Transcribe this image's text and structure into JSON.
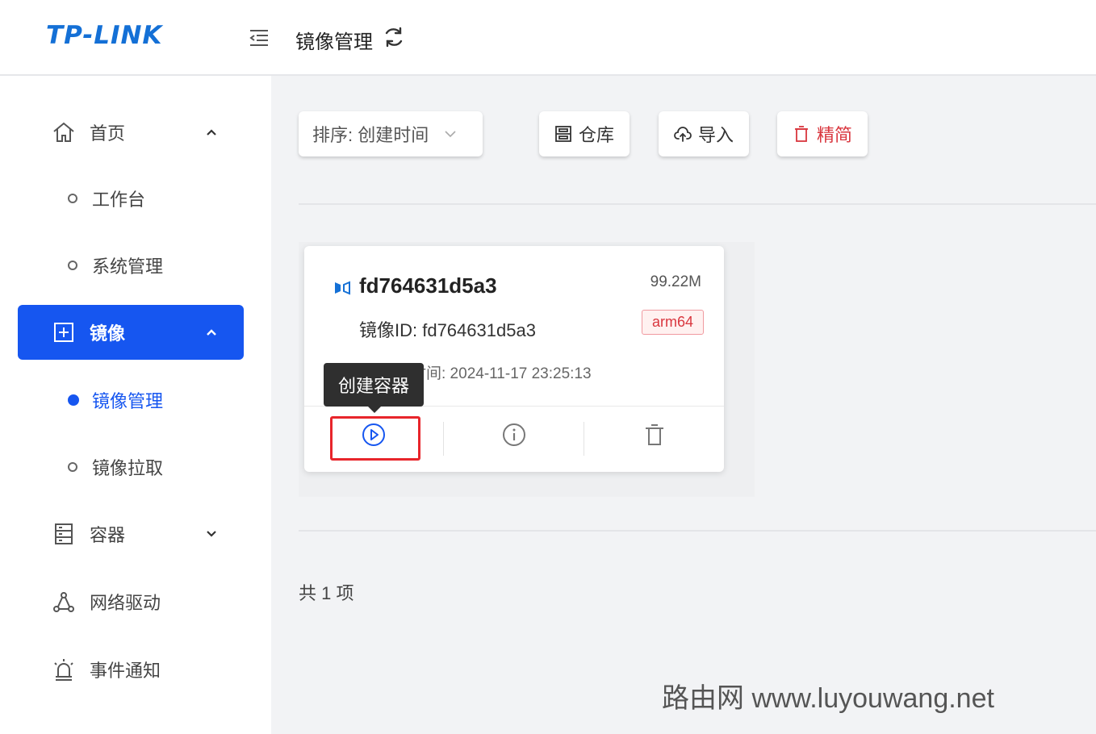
{
  "header": {
    "logo": "TP-LINK",
    "page_title": "镜像管理"
  },
  "sidebar": {
    "items": [
      {
        "label": "首页",
        "icon": "home-icon"
      },
      {
        "label": "工作台"
      },
      {
        "label": "系统管理"
      },
      {
        "label": "镜像",
        "icon": "image-icon"
      },
      {
        "label": "镜像管理"
      },
      {
        "label": "镜像拉取"
      },
      {
        "label": "容器",
        "icon": "container-icon"
      },
      {
        "label": "网络驱动",
        "icon": "network-icon"
      },
      {
        "label": "事件通知",
        "icon": "alarm-icon"
      }
    ]
  },
  "toolbar": {
    "sort_label": "排序: 创建时间",
    "warehouse_label": "仓库",
    "import_label": "导入",
    "prune_label": "精简"
  },
  "image_card": {
    "name": "fd764631d5a3",
    "size": "99.22M",
    "id_line": "镜像ID: fd764631d5a3",
    "arch": "arm64",
    "created": "创建时间: 2024-11-17 23:25:13"
  },
  "tooltip": "创建容器",
  "pagination": {
    "total": "共 1 项"
  },
  "watermark": "路由网 www.luyouwang.net",
  "colors": {
    "primary": "#1656f0",
    "danger": "#d9363e",
    "logo": "#1470d6"
  }
}
